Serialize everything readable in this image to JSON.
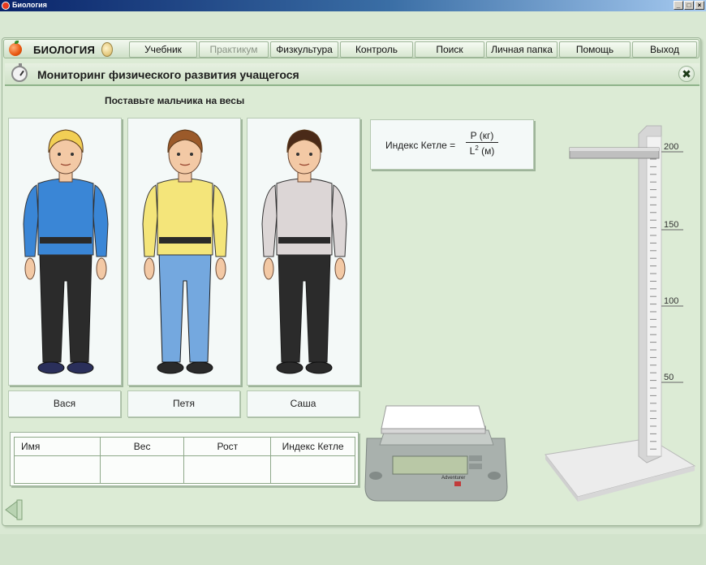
{
  "window": {
    "title": "Биология"
  },
  "menu": {
    "brand": "БИОЛОГИЯ",
    "items": [
      {
        "id": "textbook",
        "label": "Учебник",
        "enabled": true
      },
      {
        "id": "practicum",
        "label": "Практикум",
        "enabled": false
      },
      {
        "id": "fizkultura",
        "label": "Физкультура",
        "enabled": true
      },
      {
        "id": "control",
        "label": "Контроль",
        "enabled": true
      },
      {
        "id": "search",
        "label": "Поиск",
        "enabled": true
      },
      {
        "id": "folder",
        "label": "Личная папка",
        "enabled": true
      },
      {
        "id": "help",
        "label": "Помощь",
        "enabled": true
      },
      {
        "id": "exit",
        "label": "Выход",
        "enabled": true
      }
    ]
  },
  "section": {
    "title": "Мониторинг физического развития учащегося"
  },
  "instruction": "Поставьте мальчика на весы",
  "boys": [
    {
      "name": "Вася",
      "hair": "#f2cf55",
      "shirt": "#3a86d6",
      "pants": "#2b2b2b",
      "shoes": "#2a2f5a"
    },
    {
      "name": "Петя",
      "hair": "#9b5a2a",
      "shirt": "#f4e57a",
      "pants": "#74a8df",
      "shoes": "#2a2a2a"
    },
    {
      "name": "Саша",
      "hair": "#4a2a18",
      "shirt": "#dcd6d6",
      "pants": "#2b2b2b",
      "shoes": "#2a2a2a"
    }
  ],
  "table": {
    "headers": [
      "Имя",
      "Вес",
      "Рост",
      "Индекс Кетле"
    ],
    "rows": [
      [
        "",
        "",
        "",
        ""
      ]
    ]
  },
  "formula": {
    "label": "Индекс Кетле =",
    "numerator": "P (кг)",
    "denominator_base": "L",
    "denominator_exp": "2",
    "denominator_unit": " (м)"
  },
  "stadiometer": {
    "labels": [
      "200",
      "150",
      "100",
      "50"
    ]
  },
  "scale": {
    "brand": "Adventurer"
  }
}
